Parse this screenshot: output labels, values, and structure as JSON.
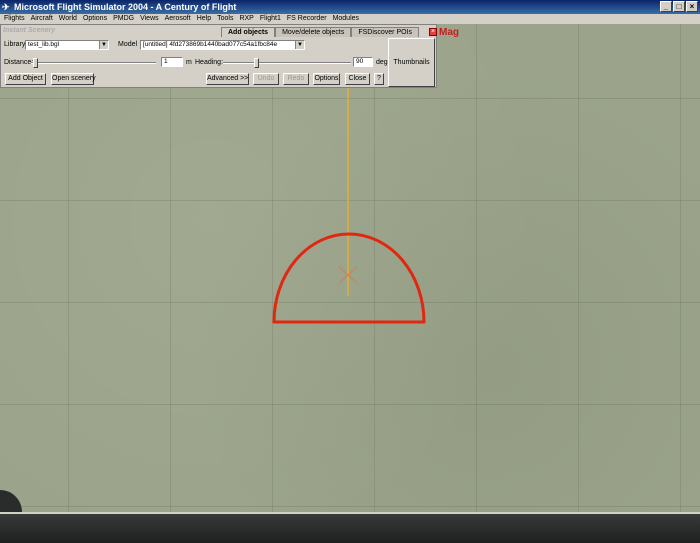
{
  "window": {
    "title": "Microsoft Flight Simulator 2004 - A Century of Flight",
    "buttons": [
      "_",
      "□",
      "×"
    ]
  },
  "menu": [
    "Flights",
    "Aircraft",
    "World",
    "Options",
    "PMDG",
    "Views",
    "Aerosoft",
    "Help",
    "Tools",
    "RXP",
    "Flight1",
    "FS Recorder",
    "Modules"
  ],
  "panel": {
    "title": "Instant Scenery",
    "tabs": [
      "Add objects",
      "Move/delete objects",
      "FSDiscover POIs"
    ],
    "active_tab": "Add objects",
    "library_label": "Library:",
    "library_value": "test_lib.bgl",
    "model_label": "Model",
    "model_value": "[untitled] 4fd273869b1440bad077c54a1fbc84e",
    "distance_label": "Distance:",
    "distance_value": "1",
    "distance_unit": "m",
    "heading_label": "Heading:",
    "heading_value": "90",
    "heading_unit": "deg",
    "distance_slider_fraction": 0.02,
    "heading_slider_fraction": 0.25,
    "buttons": {
      "add_object": "Add Object",
      "open_scenery": "Open scenery",
      "advanced": "Advanced >>",
      "undo": "Undo",
      "redo": "Redo",
      "options": "Options",
      "close": "Close",
      "help": "?"
    },
    "thumbnails": "Thumbnails",
    "mag": "Mag"
  },
  "colors": {
    "title_bar": "#0a246a",
    "outline": "#e02810",
    "heading_line": "#e8b030",
    "terrain": "#9ba48a"
  }
}
